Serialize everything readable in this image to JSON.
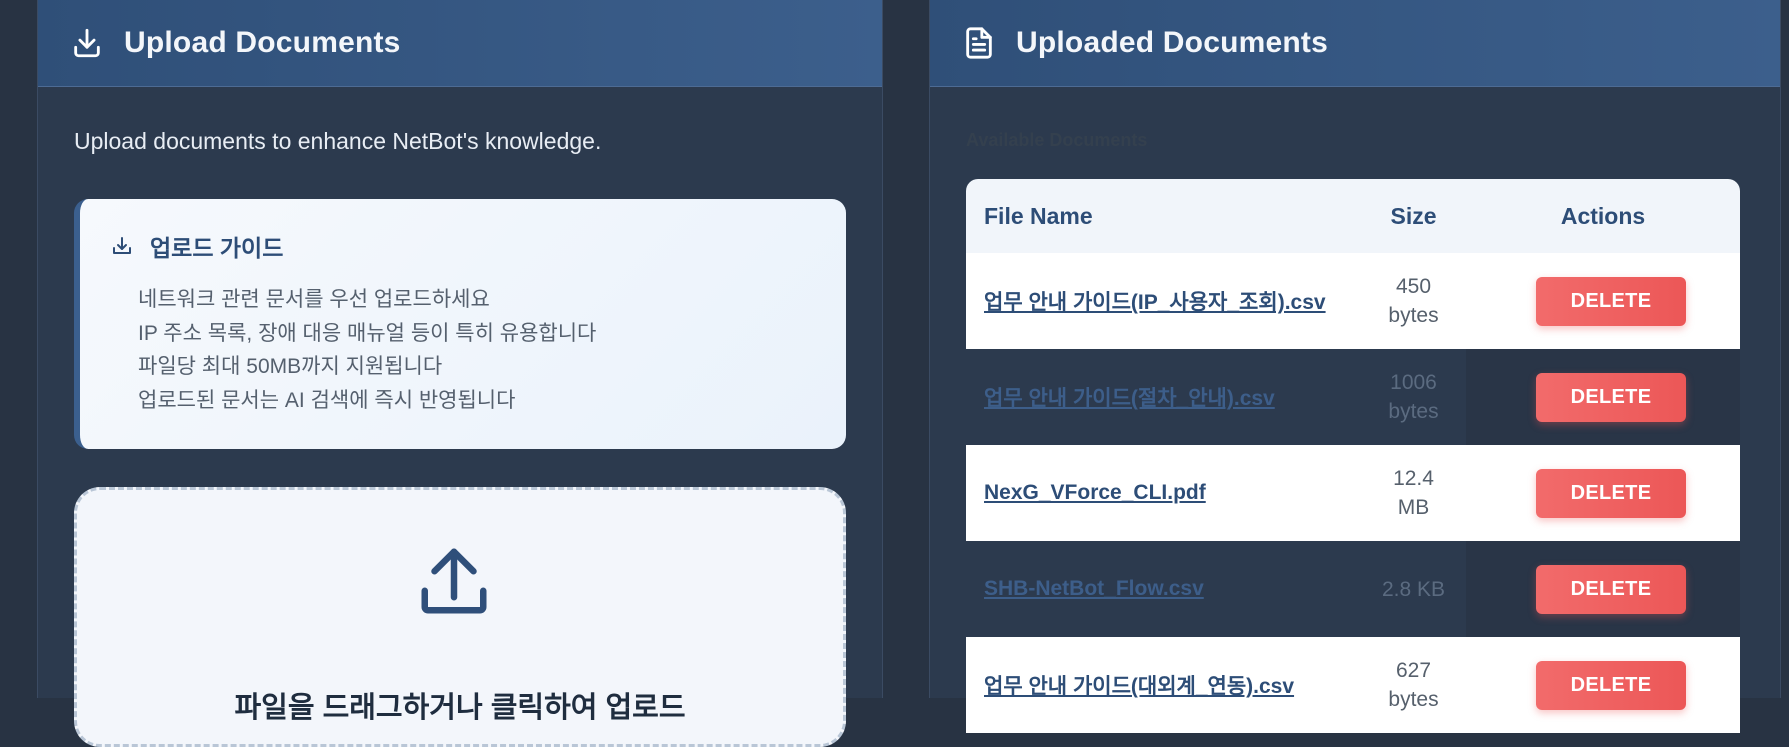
{
  "upload_panel": {
    "title": "Upload Documents",
    "header_icon": "download-icon",
    "intro": "Upload documents to enhance NetBot's knowledge.",
    "guide": {
      "icon": "upload-tray-icon",
      "title": "업로드 가이드",
      "items": [
        "네트워크 관련 문서를 우선 업로드하세요",
        "IP 주소 목록, 장애 대응 매뉴얼 등이 특히 유용합니다",
        "파일당 최대 50MB까지 지원됩니다",
        "업로드된 문서는 AI 검색에 즉시 반영됩니다"
      ]
    },
    "dropzone": {
      "icon": "upload-arrow-icon",
      "text": "파일을 드래그하거나 클릭하여 업로드"
    }
  },
  "documents_panel": {
    "title": "Uploaded Documents",
    "header_icon": "document-icon",
    "available_label": "Available Documents",
    "table": {
      "columns": [
        "File Name",
        "Size",
        "Actions"
      ],
      "rows": [
        {
          "name": "업무 안내 가이드(IP_사용자_조회).csv",
          "size": "450 bytes",
          "action": "DELETE",
          "style": "light"
        },
        {
          "name": "업무 안내 가이드(절차_안내).csv",
          "size": "1006 bytes",
          "action": "DELETE",
          "style": "dark"
        },
        {
          "name": "NexG_VForce_CLI.pdf",
          "size": "12.4 MB",
          "action": "DELETE",
          "style": "light"
        },
        {
          "name": "SHB-NetBot_Flow.csv",
          "size": "2.8 KB",
          "action": "DELETE",
          "style": "dark"
        },
        {
          "name": "업무 안내 가이드(대외계_연동).csv",
          "size": "627 bytes",
          "action": "DELETE",
          "style": "light"
        }
      ]
    }
  },
  "colors": {
    "background": "#283343",
    "panel": "#2c3a4e",
    "header": "#345683",
    "accent": "#2d4d77",
    "danger": "#ee5d5d"
  }
}
